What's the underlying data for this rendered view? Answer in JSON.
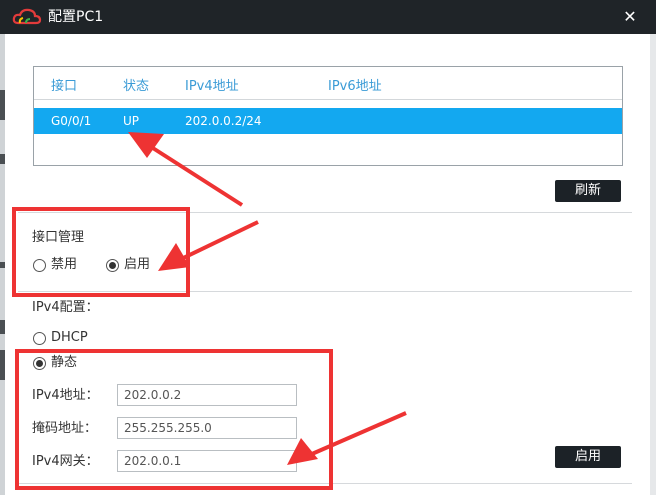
{
  "window": {
    "title": "配置PC1",
    "close_glyph": "✕"
  },
  "interfaces": {
    "headers": [
      "接口",
      "状态",
      "IPv4地址",
      "IPv6地址"
    ],
    "rows": [
      {
        "name": "G0/0/1",
        "status": "UP",
        "ipv4": "202.0.0.2/24",
        "ipv6": ""
      }
    ],
    "refresh_label": "刷新"
  },
  "iface_mgmt": {
    "title": "接口管理",
    "disable_label": "禁用",
    "enable_label": "启用",
    "selected": "启用"
  },
  "ipv4": {
    "title": "IPv4配置：",
    "dhcp_label": "DHCP",
    "static_label": "静态",
    "selected": "静态",
    "addr_label": "IPv4地址：",
    "addr_value": "202.0.0.2",
    "mask_label": "掩码地址：",
    "mask_value": "255.255.255.0",
    "gw_label": "IPv4网关：",
    "gw_value": "202.0.0.1",
    "apply_label": "启用"
  },
  "colors": {
    "titlebar": "#1f2428",
    "selected_row": "#13a8f0",
    "header_text": "#3a9bd6",
    "annotation": "#ee3333"
  },
  "icons": {
    "app": "cloud-logo-icon",
    "close": "close-icon"
  }
}
